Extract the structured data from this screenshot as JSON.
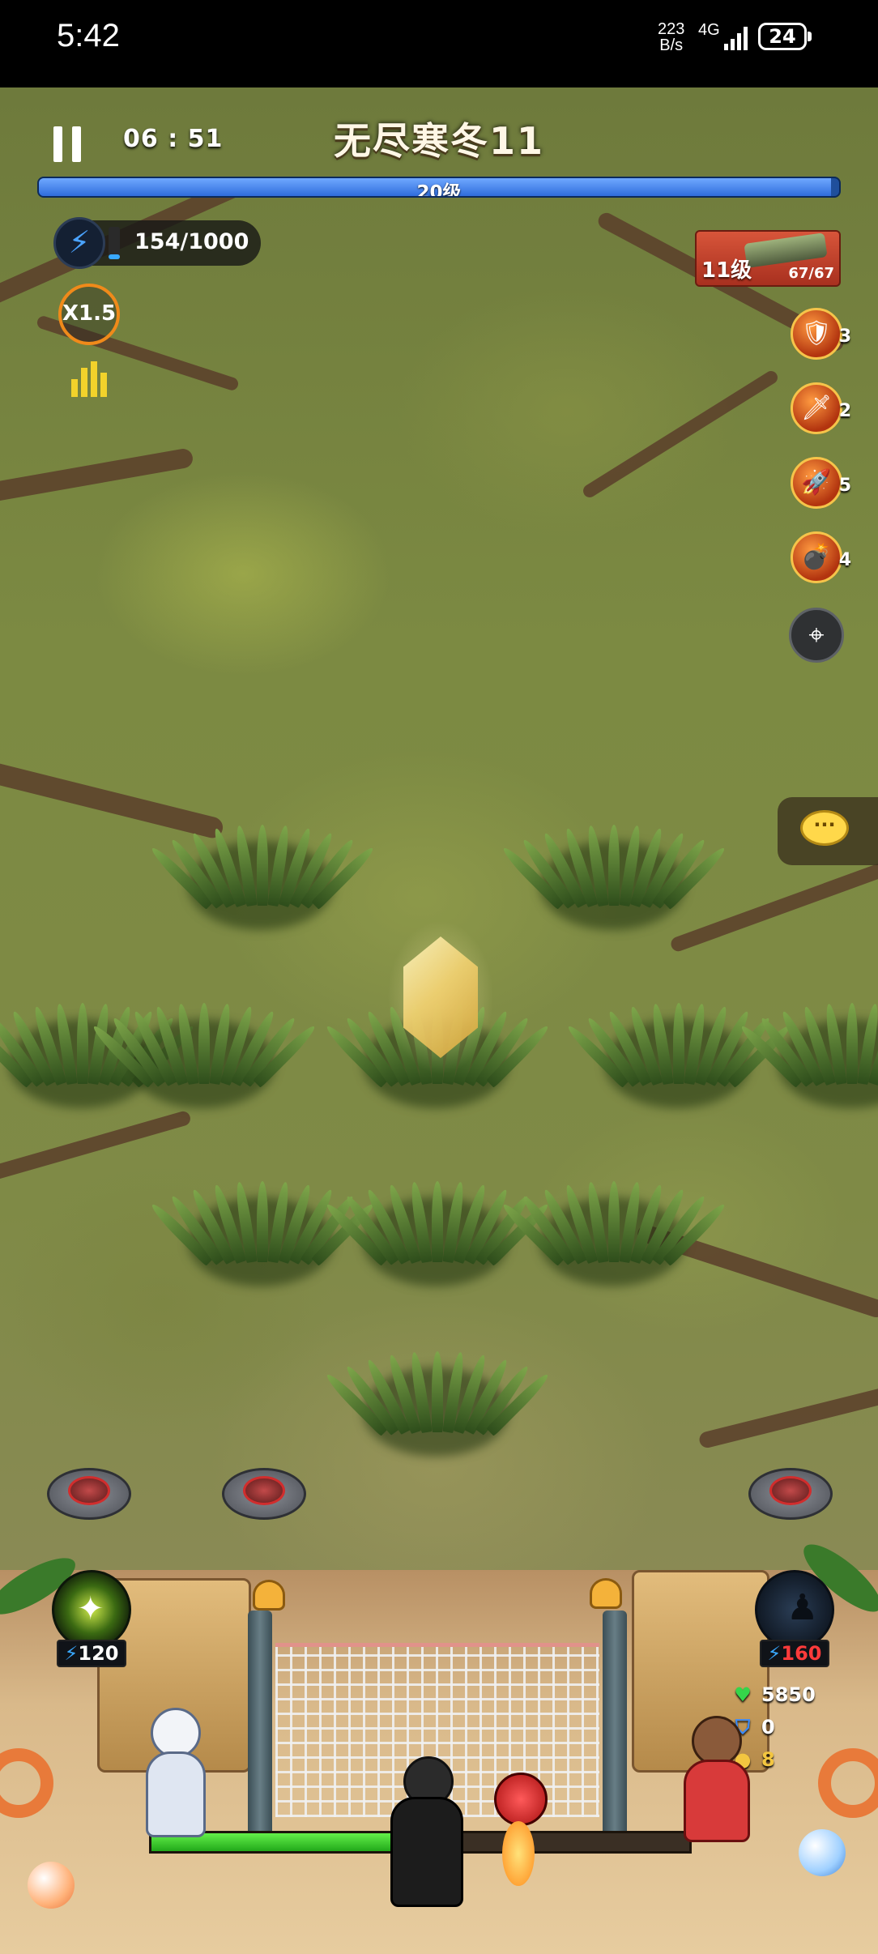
{
  "status_bar": {
    "time": "5:42",
    "net_speed_value": "223",
    "net_speed_unit": "B/s",
    "network": "4G",
    "battery": "24"
  },
  "hud": {
    "timer": "06 : 51",
    "stage_title": "无尽寒冬11",
    "player_level": "20级",
    "xp_progress": 0.99,
    "energy_text": "154/1000",
    "energy_progress": 0.154,
    "speed_multiplier": "X1.5",
    "weapon": {
      "level": "11级",
      "ammo": "67/67"
    },
    "skills": [
      {
        "icon": "armor-upgrade-icon",
        "count": "3"
      },
      {
        "icon": "fire-sword-icon",
        "count": "2"
      },
      {
        "icon": "missile-icon",
        "count": "5"
      },
      {
        "icon": "bomb-icon",
        "count": "4"
      }
    ],
    "target_icon": "crosshair-icon",
    "chat_icon": "chat-icon"
  },
  "base": {
    "left_ability_cost": "120",
    "right_ability_cost": "160",
    "hp_progress": 0.47,
    "stats": {
      "health": "5850",
      "shield": "0",
      "coins": "8"
    }
  },
  "colors": {
    "xp_bar": "#2f6ddc",
    "energy": "#39a8ff",
    "hp_bar": "#21a91a",
    "speed_ring": "#f08a1a",
    "right_cost_text": "#ff3b3b"
  }
}
